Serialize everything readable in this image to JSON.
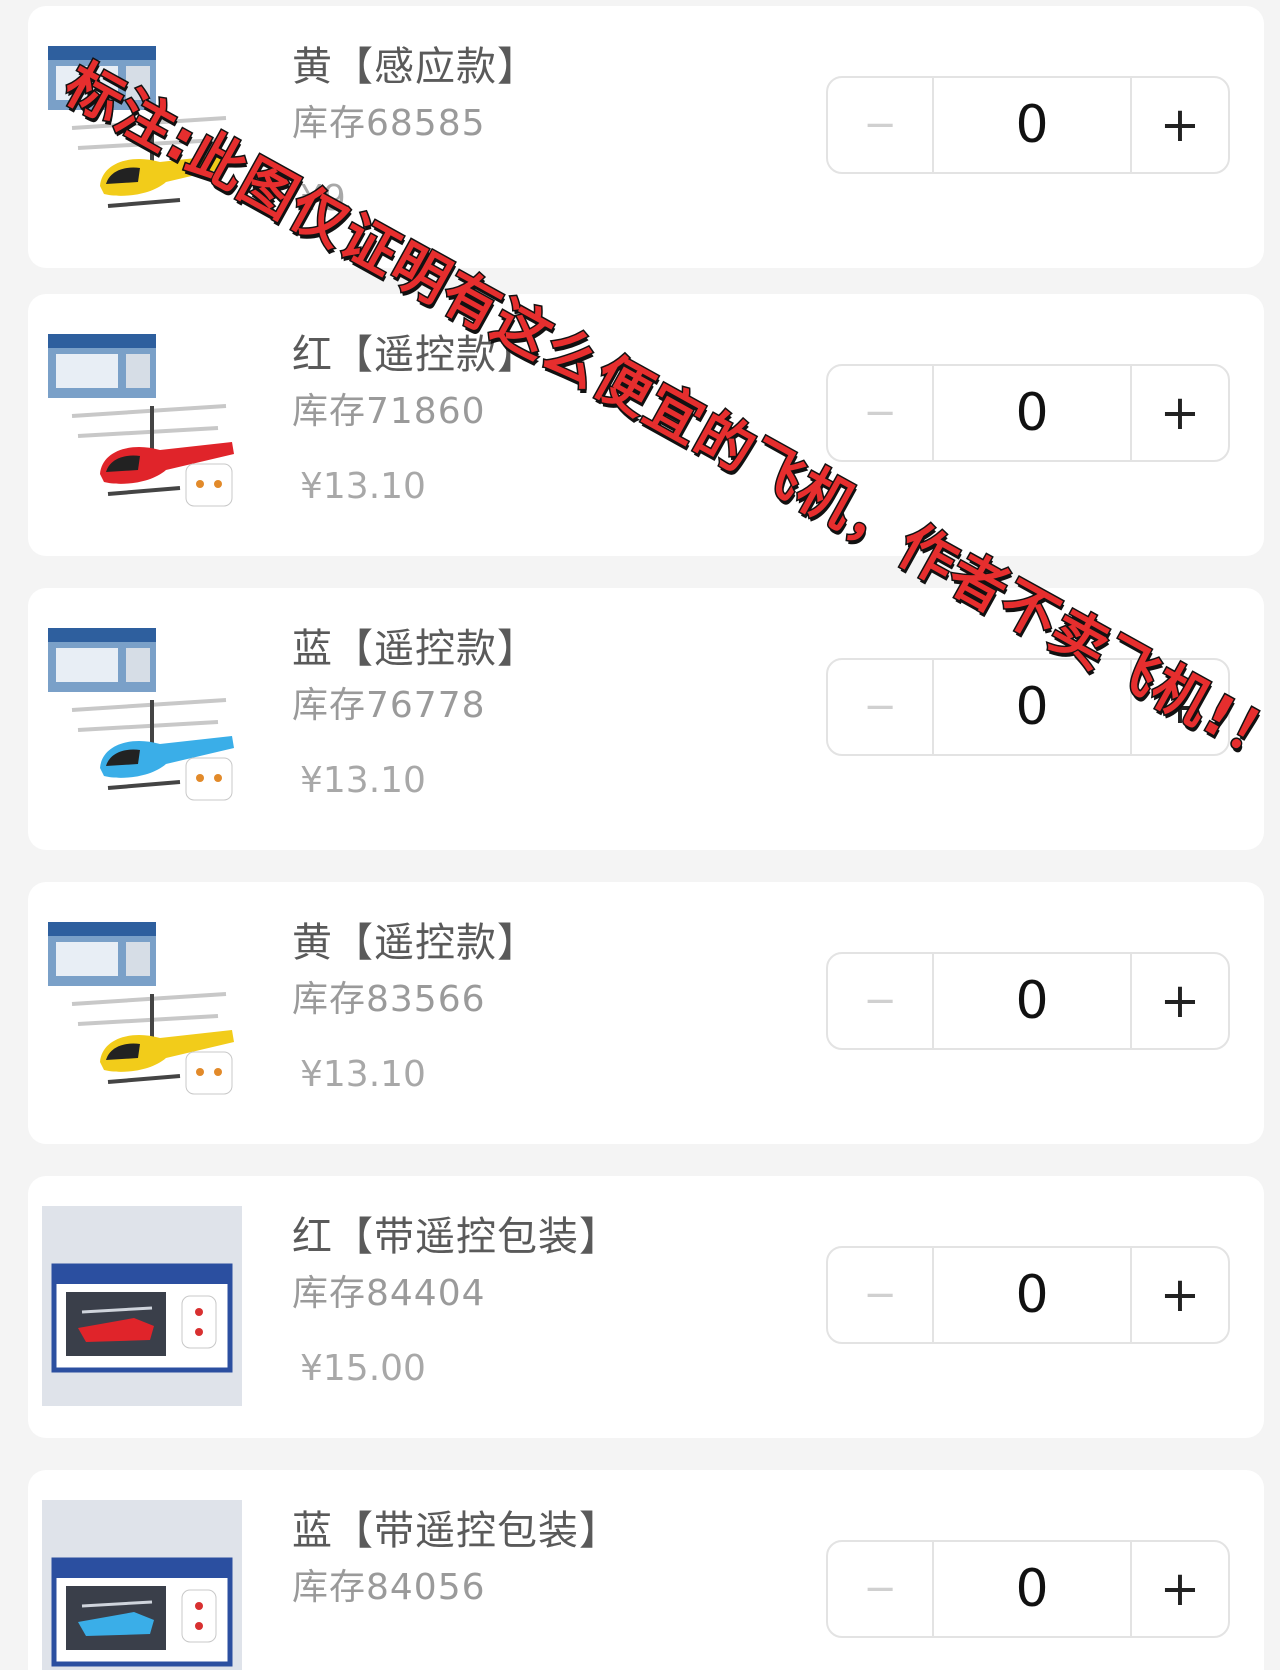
{
  "products": [
    {
      "name": "黄【感应款】",
      "stock": "库存68585",
      "price": "¥9",
      "quantity": "0",
      "color": "#f2cc1a",
      "variant": "sensor",
      "image": "yellow-helicopter-box"
    },
    {
      "name": "红【遥控款】",
      "stock": "库存71860",
      "price": "¥13.10",
      "quantity": "0",
      "color": "#e0242a",
      "variant": "remote",
      "image": "red-helicopter-box"
    },
    {
      "name": "蓝【遥控款】",
      "stock": "库存76778",
      "price": "¥13.10",
      "quantity": "0",
      "color": "#3aaee8",
      "variant": "remote",
      "image": "blue-helicopter-box"
    },
    {
      "name": "黄【遥控款】",
      "stock": "库存83566",
      "price": "¥13.10",
      "quantity": "0",
      "color": "#f2cc1a",
      "variant": "remote",
      "image": "yellow-helicopter-box"
    },
    {
      "name": "红【带遥控包装】",
      "stock": "库存84404",
      "price": "¥15.00",
      "quantity": "0",
      "color": "#e0242a",
      "variant": "package",
      "image": "red-helicopter-package"
    },
    {
      "name": "蓝【带遥控包装】",
      "stock": "库存84056",
      "price": "",
      "quantity": "0",
      "color": "#3aaee8",
      "variant": "package",
      "image": "blue-helicopter-package"
    }
  ],
  "stepper": {
    "minus": "−",
    "plus": "+"
  },
  "overlay": {
    "text": "标注:此图仅证明有这么便宜的飞机，作者不卖飞机!！",
    "color": "#e62e2e"
  }
}
